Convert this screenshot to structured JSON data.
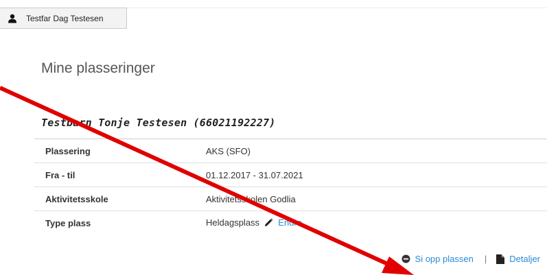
{
  "header": {
    "user_name": "Testfar Dag Testesen",
    "user_icon": "person-icon"
  },
  "page_title": "Mine plasseringer",
  "child": {
    "heading": "Testbarn Tonje Testesen (66021192227)"
  },
  "placement": {
    "rows": [
      {
        "label": "Plassering",
        "value": "AKS (SFO)"
      },
      {
        "label": "Fra - til",
        "value": "01.12.2017 - 31.07.2021"
      },
      {
        "label": "Aktivitetsskole",
        "value": "Aktivitetsskolen Godlia"
      },
      {
        "label": "Type plass",
        "value": "Heldagsplass"
      }
    ],
    "edit_label": "Endre",
    "edit_icon": "pencil-icon"
  },
  "actions": {
    "cancel_label": "Si opp plassen",
    "cancel_icon": "minus-circle-icon",
    "separator": "|",
    "details_label": "Detaljer",
    "details_icon": "document-icon"
  },
  "colors": {
    "link": "#2a8ad6",
    "annotation_arrow": "#e00000"
  }
}
